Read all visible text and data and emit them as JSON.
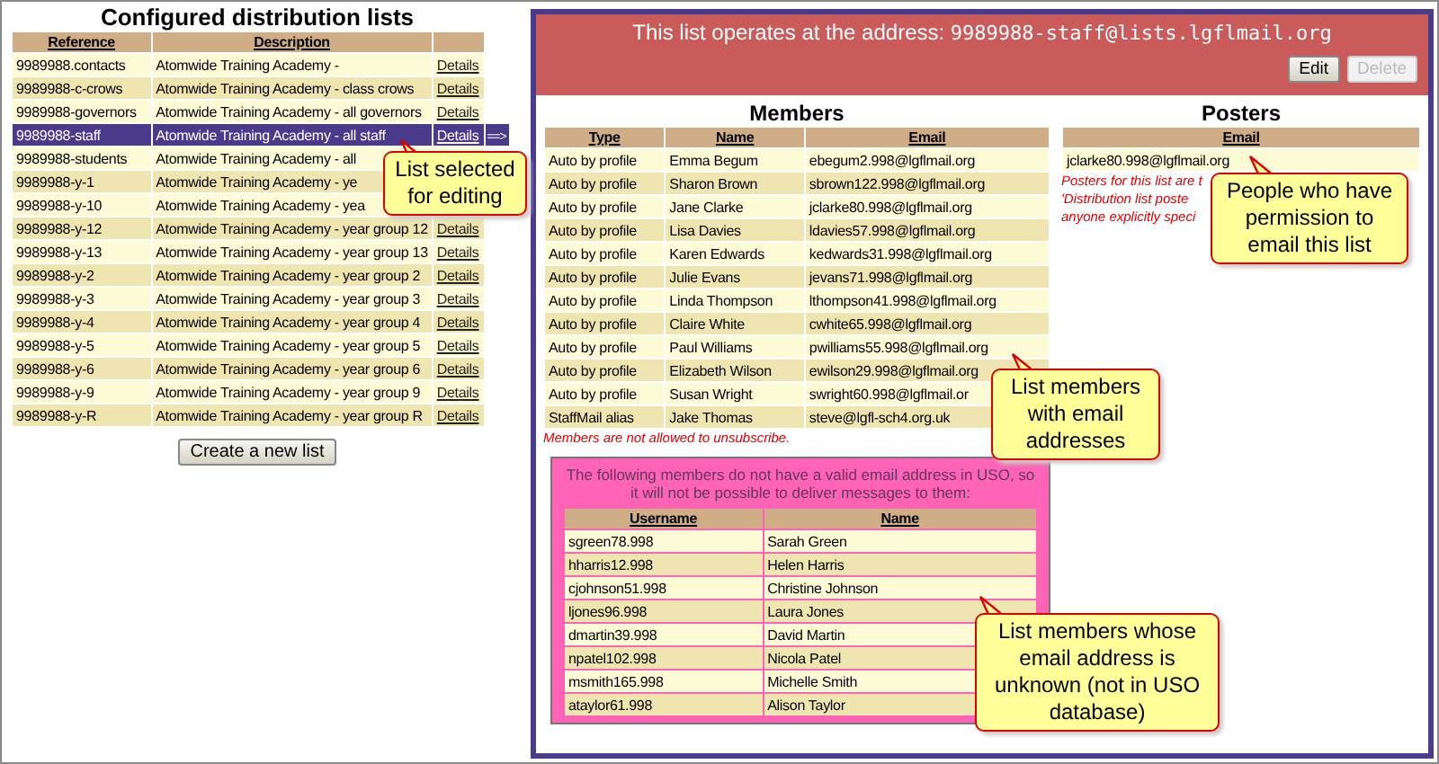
{
  "lists": {
    "title": "Configured distribution lists",
    "columns": [
      "Reference",
      "Description"
    ],
    "selected_marker": "==>",
    "rows": [
      {
        "reference": "9989988.contacts",
        "description": "Atomwide Training Academy -",
        "details": "Details",
        "selected": false
      },
      {
        "reference": "9989988-c-crows",
        "description": "Atomwide Training Academy - class crows",
        "details": "Details",
        "selected": false
      },
      {
        "reference": "9989988-governors",
        "description": "Atomwide Training Academy - all governors",
        "details": "Details",
        "selected": false
      },
      {
        "reference": "9989988-staff",
        "description": "Atomwide Training Academy - all staff",
        "details": "Details",
        "selected": true
      },
      {
        "reference": "9989988-students",
        "description": "Atomwide Training Academy - all",
        "selected": false
      },
      {
        "reference": "9989988-y-1",
        "description": "Atomwide Training Academy - ye",
        "selected": false
      },
      {
        "reference": "9989988-y-10",
        "description": "Atomwide Training Academy - yea",
        "selected": false
      },
      {
        "reference": "9989988-y-12",
        "description": "Atomwide Training Academy - year group 12",
        "details": "Details",
        "selected": false
      },
      {
        "reference": "9989988-y-13",
        "description": "Atomwide Training Academy - year group 13",
        "details": "Details",
        "selected": false
      },
      {
        "reference": "9989988-y-2",
        "description": "Atomwide Training Academy - year group 2",
        "details": "Details",
        "selected": false
      },
      {
        "reference": "9989988-y-3",
        "description": "Atomwide Training Academy - year group 3",
        "details": "Details",
        "selected": false
      },
      {
        "reference": "9989988-y-4",
        "description": "Atomwide Training Academy - year group 4",
        "details": "Details",
        "selected": false
      },
      {
        "reference": "9989988-y-5",
        "description": "Atomwide Training Academy - year group 5",
        "details": "Details",
        "selected": false
      },
      {
        "reference": "9989988-y-6",
        "description": "Atomwide Training Academy - year group 6",
        "details": "Details",
        "selected": false
      },
      {
        "reference": "9989988-y-9",
        "description": "Atomwide Training Academy - year group 9",
        "details": "Details",
        "selected": false
      },
      {
        "reference": "9989988-y-R",
        "description": "Atomwide Training Academy - year group R",
        "details": "Details",
        "selected": false
      }
    ],
    "create_button": "Create a new list"
  },
  "detail": {
    "address_label": "This list operates at the address:",
    "address": "9989988-staff@lists.lgflmail.org",
    "buttons": [
      {
        "label": "Edit",
        "disabled": false
      },
      {
        "label": "Delete",
        "disabled": true
      }
    ],
    "members": {
      "title": "Members",
      "columns": [
        "Type",
        "Name",
        "Email"
      ],
      "rows": [
        [
          "Auto by profile",
          "Emma Begum",
          "ebegum2.998@lgflmail.org"
        ],
        [
          "Auto by profile",
          "Sharon Brown",
          "sbrown122.998@lgflmail.org"
        ],
        [
          "Auto by profile",
          "Jane Clarke",
          "jclarke80.998@lgflmail.org"
        ],
        [
          "Auto by profile",
          "Lisa Davies",
          "ldavies57.998@lgflmail.org"
        ],
        [
          "Auto by profile",
          "Karen Edwards",
          "kedwards31.998@lgflmail.org"
        ],
        [
          "Auto by profile",
          "Julie Evans",
          "jevans71.998@lgflmail.org"
        ],
        [
          "Auto by profile",
          "Linda Thompson",
          "lthompson41.998@lgflmail.org"
        ],
        [
          "Auto by profile",
          "Claire White",
          "cwhite65.998@lgflmail.org"
        ],
        [
          "Auto by profile",
          "Paul Williams",
          "pwilliams55.998@lgflmail.org"
        ],
        [
          "Auto by profile",
          "Elizabeth Wilson",
          "ewilson29.998@lgflmail.org"
        ],
        [
          "Auto by profile",
          "Susan Wright",
          "swright60.998@lgflmail.or"
        ],
        [
          "StaffMail alias",
          "Jake Thomas",
          "steve@lgfl-sch4.org.uk"
        ]
      ],
      "note": "Members are not allowed to unsubscribe."
    },
    "posters": {
      "title": "Posters",
      "columns": [
        "Email"
      ],
      "rows": [
        [
          "jclarke80.998@lgflmail.org"
        ]
      ],
      "note_lines": [
        "Posters for this list are t",
        "'Distribution list poste",
        "anyone explicitly speci"
      ]
    },
    "unknown": {
      "message": "The following members do not have a valid email address in USO, so it will not be possible to deliver messages to them:",
      "columns": [
        "Username",
        "Name"
      ],
      "rows": [
        [
          "sgreen78.998",
          "Sarah Green"
        ],
        [
          "hharris12.998",
          "Helen Harris"
        ],
        [
          "cjohnson51.998",
          "Christine Johnson"
        ],
        [
          "ljones96.998",
          "Laura Jones"
        ],
        [
          "dmartin39.998",
          "David Martin"
        ],
        [
          "npatel102.998",
          "Nicola Patel"
        ],
        [
          "msmith165.998",
          "Michelle Smith"
        ],
        [
          "ataylor61.998",
          "Alison Taylor"
        ]
      ]
    }
  },
  "callouts": [
    {
      "text": "List selected for editing"
    },
    {
      "text": "People who have permission to email this list"
    },
    {
      "text": "List members with email addresses"
    },
    {
      "text": "List members whose email address is unknown (not in USO database)"
    }
  ]
}
